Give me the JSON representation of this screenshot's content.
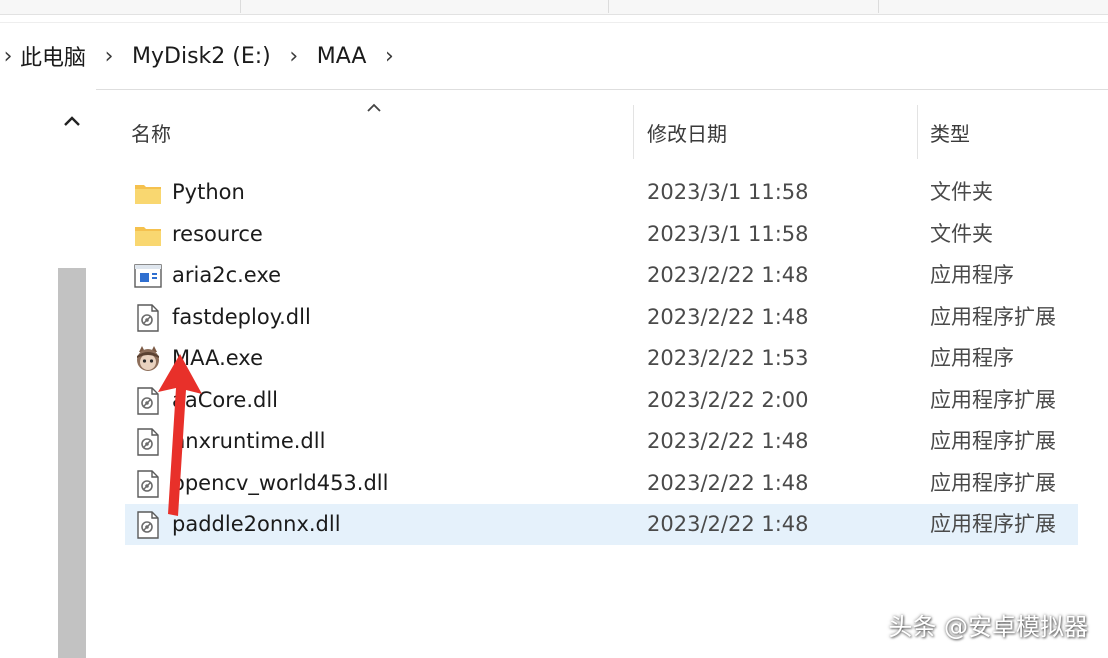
{
  "breadcrumb": {
    "items": [
      "此电脑",
      "MyDisk2 (E:)",
      "MAA"
    ]
  },
  "columns": {
    "name": "名称",
    "date": "修改日期",
    "type": "类型"
  },
  "files": [
    {
      "name": "Python",
      "date": "2023/3/1 11:58",
      "type": "文件夹",
      "icon": "folder-icon"
    },
    {
      "name": "resource",
      "date": "2023/3/1 11:58",
      "type": "文件夹",
      "icon": "folder-icon"
    },
    {
      "name": "aria2c.exe",
      "date": "2023/2/22 1:48",
      "type": "应用程序",
      "icon": "exe-icon"
    },
    {
      "name": "fastdeploy.dll",
      "date": "2023/2/22 1:48",
      "type": "应用程序扩展",
      "icon": "dll-icon"
    },
    {
      "name": "MAA.exe",
      "date": "2023/2/22 1:53",
      "type": "应用程序",
      "icon": "maa-app-icon"
    },
    {
      "name": "aaCore.dll",
      "date": "2023/2/22 2:00",
      "type": "应用程序扩展",
      "icon": "dll-icon"
    },
    {
      "name": "nnxruntime.dll",
      "date": "2023/2/22 1:48",
      "type": "应用程序扩展",
      "icon": "dll-icon"
    },
    {
      "name": "opencv_world453.dll",
      "date": "2023/2/22 1:48",
      "type": "应用程序扩展",
      "icon": "dll-icon"
    },
    {
      "name": "paddle2onnx.dll",
      "date": "2023/2/22 1:48",
      "type": "应用程序扩展",
      "icon": "dll-icon"
    }
  ],
  "selected_index": 8,
  "watermark": "头条 @安卓模拟器",
  "colors": {
    "selection": "#e5f1fb",
    "folder": "#f8d66d",
    "arrow": "#e8302a"
  }
}
